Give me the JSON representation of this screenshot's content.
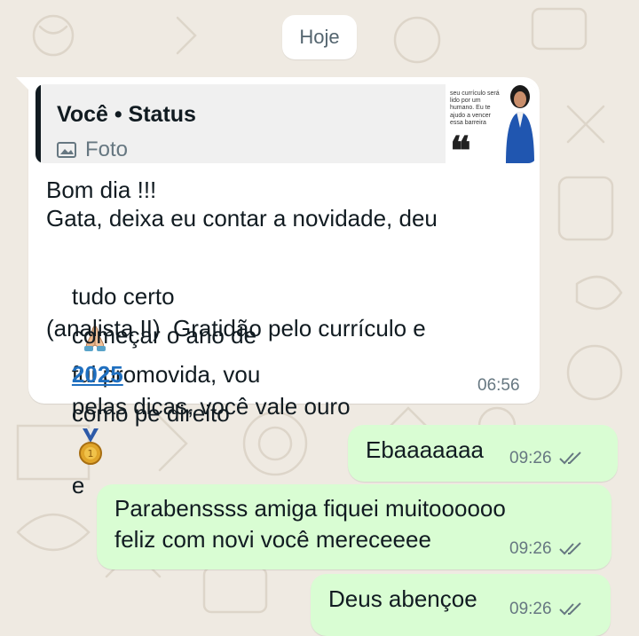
{
  "date_chip": "Hoje",
  "messages": {
    "incoming": {
      "reply": {
        "author": "Você • Status",
        "type": "Foto",
        "thumbnail_text": "seu currículo será lido por um humano. Eu te ajudo a vencer essa barreira"
      },
      "line1": "Bom dia !!!",
      "line2": "Gata, deixa eu contar a novidade, deu",
      "line3a": "tudo certo",
      "line3b": "fui promovida, vou",
      "line4a": "começar o ano de",
      "line4_link": "2025",
      "line4b": "como pe direito",
      "line5": "(analista II)  Gratidão pelo currículo e",
      "line6a": "pelas dicas, você vale ouro",
      "line6b": "e",
      "time": "06:56"
    },
    "out1": {
      "text": "Ebaaaaaaa",
      "time": "09:26"
    },
    "out2": {
      "line1": "Parabenssss amiga fiquei muitoooooo",
      "line2": "feliz com novi você mereceeee",
      "time": "09:26"
    },
    "out3": {
      "text": "Deus abençoe",
      "time": "09:26"
    }
  },
  "icons": [
    "photo-icon",
    "praying-hands-icon",
    "medal-icon",
    "read-receipt-icon"
  ],
  "colors": {
    "background": "#efeae2",
    "incoming_bubble": "#ffffff",
    "outgoing_bubble": "#d9fdd3",
    "link": "#1f6fbf",
    "tick": "#667781"
  }
}
